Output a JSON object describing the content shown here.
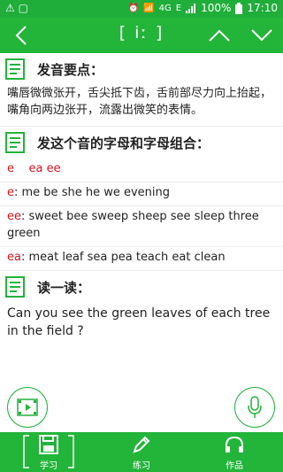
{
  "status_bar": {
    "left_icons": "⚠ ▢",
    "network": "4G",
    "signal_extra": "E",
    "battery": "100%",
    "time": "17:10"
  },
  "header": {
    "title": "[ iː ]",
    "back_icon": "back-chevron-icon",
    "prev_icon": "chevron-up-icon",
    "next_icon": "chevron-down-icon"
  },
  "sections": {
    "pronunciation": {
      "title": "发音要点：",
      "text": "嘴唇微微张开，舌尖抵下齿，舌前部尽力向上抬起，嘴角向两边张开，流露出微笑的表情。"
    },
    "letters": {
      "title": "发这个音的字母和字母组合：",
      "summary": "e    ea ee",
      "rows": [
        {
          "key": "e",
          "words": ": me be she he we evening"
        },
        {
          "key": "ee",
          "words": ": sweet bee sweep sheep see sleep three green"
        },
        {
          "key": "ea",
          "words": ": meat leaf sea pea teach eat clean"
        }
      ]
    },
    "reading": {
      "title": "读一读：",
      "text": "Can you see the green leaves of each tree in the field ?"
    }
  },
  "bottom_nav": [
    {
      "label": "学习",
      "icon": "floppy-disk-icon"
    },
    {
      "label": "练习",
      "icon": "pencil-icon"
    },
    {
      "label": "作品",
      "icon": "headphones-icon"
    }
  ],
  "colors": {
    "primary": "#23b43a",
    "accent_red": "#d2141e"
  }
}
